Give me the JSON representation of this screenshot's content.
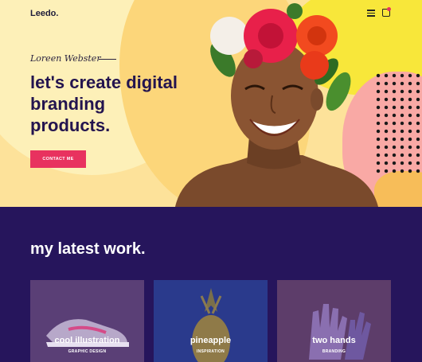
{
  "header": {
    "logo": "Leedo."
  },
  "hero": {
    "signature": "Loreen Webster",
    "headline": "let's create digital branding products.",
    "cta_label": "CONTACT ME"
  },
  "work": {
    "title": "my latest work.",
    "cards": [
      {
        "title": "cool illustration",
        "category": "GRAPHIC DESIGN"
      },
      {
        "title": "pineapple",
        "category": "INSPIRATION"
      },
      {
        "title": "two hands",
        "category": "BRANDING"
      }
    ]
  },
  "colors": {
    "accent": "#e8325f",
    "dark_bg": "#26155c",
    "hero_bg": "#fde29a"
  },
  "icons": [
    "menu-icon",
    "cart-icon"
  ]
}
